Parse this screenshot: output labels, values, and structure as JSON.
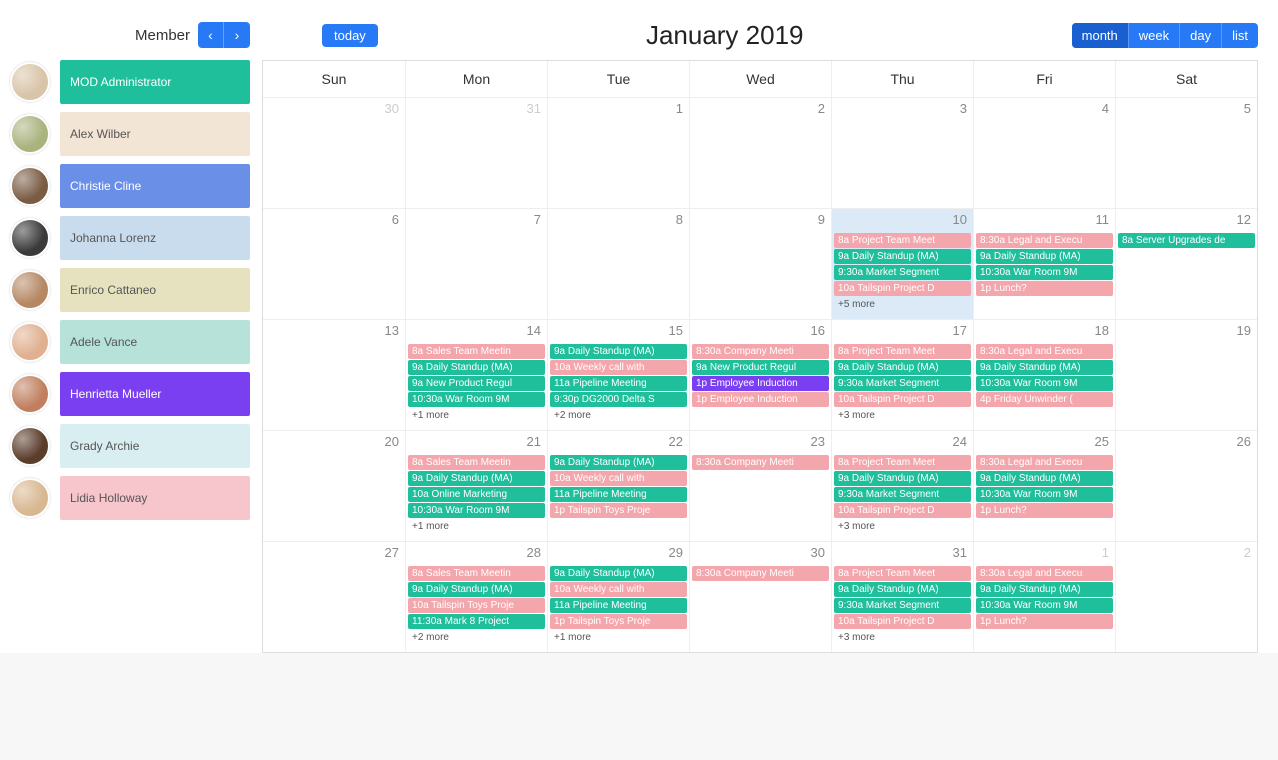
{
  "sidebar": {
    "heading": "Member",
    "members": [
      {
        "name": "MOD Administrator",
        "color": "#1fbf9c",
        "avatar": "#d8c4a8",
        "text": "#fff"
      },
      {
        "name": "Alex Wilber",
        "color": "#f3e5d5",
        "avatar": "#a9b37e",
        "text": "#555"
      },
      {
        "name": "Christie Cline",
        "color": "#6a8fe6",
        "avatar": "#7a5c44",
        "text": "#fff"
      },
      {
        "name": "Johanna Lorenz",
        "color": "#c9dced",
        "avatar": "#3a3a3a",
        "text": "#555"
      },
      {
        "name": "Enrico Cattaneo",
        "color": "#e6e2c0",
        "avatar": "#b58863",
        "text": "#555"
      },
      {
        "name": "Adele Vance",
        "color": "#b6e2da",
        "avatar": "#e0b090",
        "text": "#555"
      },
      {
        "name": "Henrietta Mueller",
        "color": "#7b3ff2",
        "avatar": "#c08060",
        "text": "#fff"
      },
      {
        "name": "Grady Archie",
        "color": "#d9eef1",
        "avatar": "#5a3d2b",
        "text": "#555"
      },
      {
        "name": "Lidia Holloway",
        "color": "#f7c6cc",
        "avatar": "#d8b890",
        "text": "#555"
      }
    ]
  },
  "toolbar": {
    "today": "today",
    "title": "January 2019",
    "views": [
      "month",
      "week",
      "day",
      "list"
    ],
    "active_view": "month"
  },
  "colors": {
    "teal": "#1fbf9c",
    "pink": "#f4a6ad",
    "purple": "#7b3ff2"
  },
  "dow": [
    "Sun",
    "Mon",
    "Tue",
    "Wed",
    "Thu",
    "Fri",
    "Sat"
  ],
  "weeks": [
    {
      "days": [
        {
          "n": "30",
          "other": true,
          "events": []
        },
        {
          "n": "31",
          "other": true,
          "events": []
        },
        {
          "n": "1",
          "events": []
        },
        {
          "n": "2",
          "events": []
        },
        {
          "n": "3",
          "events": []
        },
        {
          "n": "4",
          "events": []
        },
        {
          "n": "5",
          "events": []
        }
      ]
    },
    {
      "days": [
        {
          "n": "6",
          "events": []
        },
        {
          "n": "7",
          "events": []
        },
        {
          "n": "8",
          "events": []
        },
        {
          "n": "9",
          "events": []
        },
        {
          "n": "10",
          "today": true,
          "events": [
            {
              "t": "8a Project Team Meet",
              "c": "pink"
            },
            {
              "t": "9a Daily Standup (MA)",
              "c": "teal"
            },
            {
              "t": "9:30a Market Segment",
              "c": "teal"
            },
            {
              "t": "10a Tailspin Project D",
              "c": "pink"
            }
          ],
          "more": "+5 more"
        },
        {
          "n": "11",
          "events": [
            {
              "t": "8:30a Legal and Execu",
              "c": "pink"
            },
            {
              "t": "9a Daily Standup (MA)",
              "c": "teal"
            },
            {
              "t": "10:30a War Room 9M",
              "c": "teal"
            },
            {
              "t": "1p Lunch?",
              "c": "pink"
            }
          ]
        },
        {
          "n": "12",
          "events": [
            {
              "t": "8a Server Upgrades de",
              "c": "teal"
            }
          ]
        }
      ]
    },
    {
      "days": [
        {
          "n": "13",
          "events": []
        },
        {
          "n": "14",
          "events": [
            {
              "t": "8a Sales Team Meetin",
              "c": "pink"
            },
            {
              "t": "9a Daily Standup (MA)",
              "c": "teal"
            },
            {
              "t": "9a New Product Regul",
              "c": "teal"
            },
            {
              "t": "10:30a War Room 9M",
              "c": "teal"
            }
          ],
          "more": "+1 more"
        },
        {
          "n": "15",
          "events": [
            {
              "t": "9a Daily Standup (MA)",
              "c": "teal"
            },
            {
              "t": "10a Weekly call with",
              "c": "pink"
            },
            {
              "t": "11a Pipeline Meeting",
              "c": "teal"
            },
            {
              "t": "9:30p DG2000 Delta S",
              "c": "teal"
            }
          ],
          "more": "+2 more"
        },
        {
          "n": "16",
          "events": [
            {
              "t": "8:30a Company Meeti",
              "c": "pink"
            },
            {
              "t": "9a New Product Regul",
              "c": "teal"
            },
            {
              "t": "1p Employee Induction",
              "c": "purple"
            },
            {
              "t": "1p Employee Induction",
              "c": "pink"
            }
          ]
        },
        {
          "n": "17",
          "events": [
            {
              "t": "8a Project Team Meet",
              "c": "pink"
            },
            {
              "t": "9a Daily Standup (MA)",
              "c": "teal"
            },
            {
              "t": "9:30a Market Segment",
              "c": "teal"
            },
            {
              "t": "10a Tailspin Project D",
              "c": "pink"
            }
          ],
          "more": "+3 more"
        },
        {
          "n": "18",
          "events": [
            {
              "t": "8:30a Legal and Execu",
              "c": "pink"
            },
            {
              "t": "9a Daily Standup (MA)",
              "c": "teal"
            },
            {
              "t": "10:30a War Room 9M",
              "c": "teal"
            },
            {
              "t": "4p Friday Unwinder (",
              "c": "pink"
            }
          ]
        },
        {
          "n": "19",
          "events": []
        }
      ]
    },
    {
      "days": [
        {
          "n": "20",
          "events": []
        },
        {
          "n": "21",
          "events": [
            {
              "t": "8a Sales Team Meetin",
              "c": "pink"
            },
            {
              "t": "9a Daily Standup (MA)",
              "c": "teal"
            },
            {
              "t": "10a Online Marketing",
              "c": "teal"
            },
            {
              "t": "10:30a War Room 9M",
              "c": "teal"
            }
          ],
          "more": "+1 more"
        },
        {
          "n": "22",
          "events": [
            {
              "t": "9a Daily Standup (MA)",
              "c": "teal"
            },
            {
              "t": "10a Weekly call with",
              "c": "pink"
            },
            {
              "t": "11a Pipeline Meeting",
              "c": "teal"
            },
            {
              "t": "1p Tailspin Toys Proje",
              "c": "pink"
            }
          ]
        },
        {
          "n": "23",
          "events": [
            {
              "t": "8:30a Company Meeti",
              "c": "pink"
            }
          ]
        },
        {
          "n": "24",
          "events": [
            {
              "t": "8a Project Team Meet",
              "c": "pink"
            },
            {
              "t": "9a Daily Standup (MA)",
              "c": "teal"
            },
            {
              "t": "9:30a Market Segment",
              "c": "teal"
            },
            {
              "t": "10a Tailspin Project D",
              "c": "pink"
            }
          ],
          "more": "+3 more"
        },
        {
          "n": "25",
          "events": [
            {
              "t": "8:30a Legal and Execu",
              "c": "pink"
            },
            {
              "t": "9a Daily Standup (MA)",
              "c": "teal"
            },
            {
              "t": "10:30a War Room 9M",
              "c": "teal"
            },
            {
              "t": "1p Lunch?",
              "c": "pink"
            }
          ]
        },
        {
          "n": "26",
          "events": []
        }
      ]
    },
    {
      "days": [
        {
          "n": "27",
          "events": []
        },
        {
          "n": "28",
          "events": [
            {
              "t": "8a Sales Team Meetin",
              "c": "pink"
            },
            {
              "t": "9a Daily Standup (MA)",
              "c": "teal"
            },
            {
              "t": "10a Tailspin Toys Proje",
              "c": "pink"
            },
            {
              "t": "11:30a Mark 8 Project",
              "c": "teal"
            }
          ],
          "more": "+2 more"
        },
        {
          "n": "29",
          "events": [
            {
              "t": "9a Daily Standup (MA)",
              "c": "teal"
            },
            {
              "t": "10a Weekly call with",
              "c": "pink"
            },
            {
              "t": "11a Pipeline Meeting",
              "c": "teal"
            },
            {
              "t": "1p Tailspin Toys Proje",
              "c": "pink"
            }
          ],
          "more": "+1 more"
        },
        {
          "n": "30",
          "events": [
            {
              "t": "8:30a Company Meeti",
              "c": "pink"
            }
          ]
        },
        {
          "n": "31",
          "events": [
            {
              "t": "8a Project Team Meet",
              "c": "pink"
            },
            {
              "t": "9a Daily Standup (MA)",
              "c": "teal"
            },
            {
              "t": "9:30a Market Segment",
              "c": "teal"
            },
            {
              "t": "10a Tailspin Project D",
              "c": "pink"
            }
          ],
          "more": "+3 more"
        },
        {
          "n": "1",
          "other": true,
          "events": [
            {
              "t": "8:30a Legal and Execu",
              "c": "pink"
            },
            {
              "t": "9a Daily Standup (MA)",
              "c": "teal"
            },
            {
              "t": "10:30a War Room 9M",
              "c": "teal"
            },
            {
              "t": "1p Lunch?",
              "c": "pink"
            }
          ]
        },
        {
          "n": "2",
          "other": true,
          "events": []
        }
      ]
    }
  ]
}
